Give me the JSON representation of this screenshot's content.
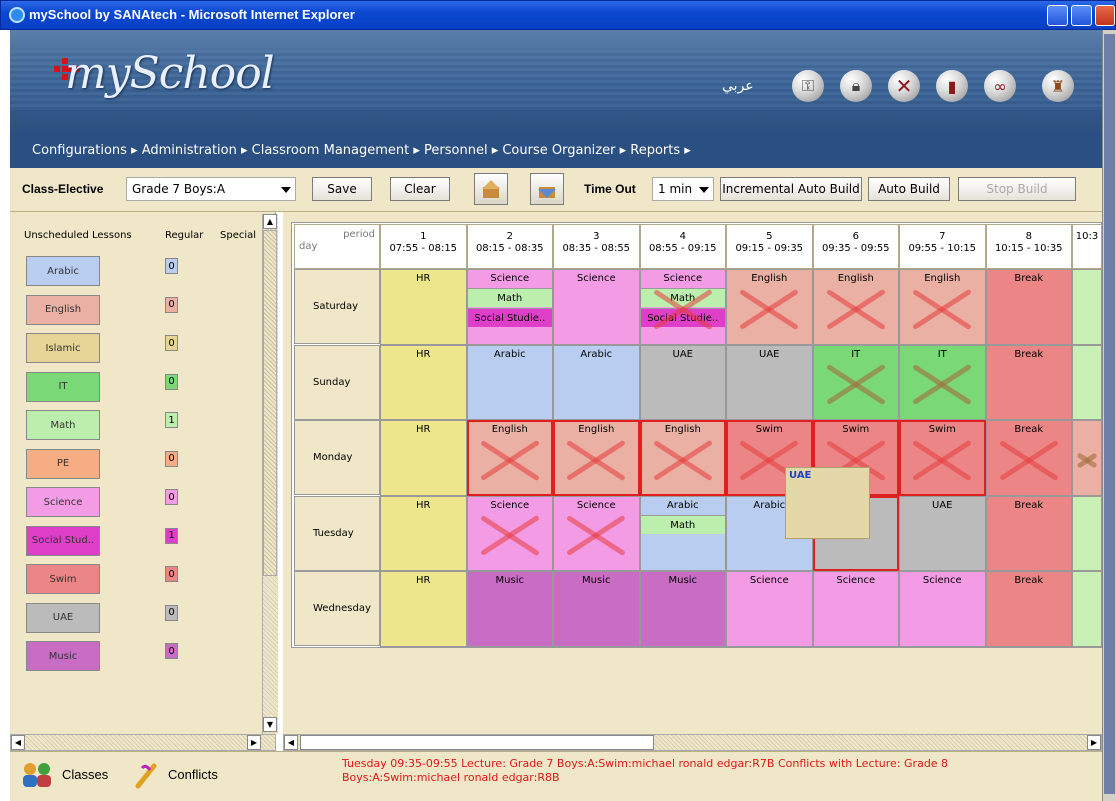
{
  "window": {
    "title": "mySchool by SANAtech - Microsoft Internet Explorer"
  },
  "header": {
    "logo_text": "mySchool",
    "language_link": "عربي",
    "icons": [
      "key-icon",
      "lock-icon",
      "cancel-icon",
      "logout-door-icon",
      "glasses-icon",
      "tag-icon"
    ]
  },
  "menu": {
    "text": "Configurations ▸ Administration ▸ Classroom Management ▸ Personnel ▸ Course Organizer ▸ Reports ▸"
  },
  "toolbar": {
    "class_label": "Class-Elective",
    "class_value": "Grade 7 Boys:A",
    "save": "Save",
    "clear": "Clear",
    "timeout_label": "Time Out",
    "timeout_value": "1 min",
    "incremental": "Incremental Auto Build",
    "auto_build": "Auto Build",
    "stop_build": "Stop Build"
  },
  "left_panel": {
    "headers": {
      "lessons": "Unscheduled Lessons",
      "regular": "Regular",
      "special": "Special"
    },
    "lessons": [
      {
        "name": "Arabic",
        "count": "0",
        "color": "#b8cdf0"
      },
      {
        "name": "English",
        "count": "0",
        "color": "#eab0a4"
      },
      {
        "name": "Islamic",
        "count": "0",
        "color": "#e6d596"
      },
      {
        "name": "IT",
        "count": "0",
        "color": "#7ad876"
      },
      {
        "name": "Math",
        "count": "1",
        "color": "#bcefae"
      },
      {
        "name": "PE",
        "count": "0",
        "color": "#f6ad84"
      },
      {
        "name": "Science",
        "count": "0",
        "color": "#f39be4"
      },
      {
        "name": "Social Stud..",
        "count": "1",
        "color": "#de3ec8"
      },
      {
        "name": "Swim",
        "count": "0",
        "color": "#ec8686"
      },
      {
        "name": "UAE",
        "count": "0",
        "color": "#bbbbbb"
      },
      {
        "name": "Music",
        "count": "0",
        "color": "#c86cc4"
      }
    ]
  },
  "timetable": {
    "corner": {
      "period": "period",
      "day": "day"
    },
    "periods": [
      {
        "num": "1",
        "time": "07:55 - 08:15"
      },
      {
        "num": "2",
        "time": "08:15 - 08:35"
      },
      {
        "num": "3",
        "time": "08:35 - 08:55"
      },
      {
        "num": "4",
        "time": "08:55 - 09:15"
      },
      {
        "num": "5",
        "time": "09:15 - 09:35"
      },
      {
        "num": "6",
        "time": "09:35 - 09:55"
      },
      {
        "num": "7",
        "time": "09:55 - 10:15"
      },
      {
        "num": "8",
        "time": "10:15 - 10:35"
      },
      {
        "num": "",
        "time": "10:3"
      }
    ],
    "days": [
      "Saturday",
      "Sunday",
      "Monday",
      "Tuesday",
      "Wednesday"
    ],
    "drag_label": "UAE",
    "hr": "HR",
    "break": "Break"
  },
  "status": {
    "tab_classes": "Classes",
    "tab_conflicts": "Conflicts",
    "message": "Tuesday 09:35-09:55 Lecture: Grade 7 Boys:A:Swim:michael ronald edgar:R7B Conflicts with Lecture: Grade 8 Boys:A:Swim:michael ronald edgar:R8B"
  }
}
